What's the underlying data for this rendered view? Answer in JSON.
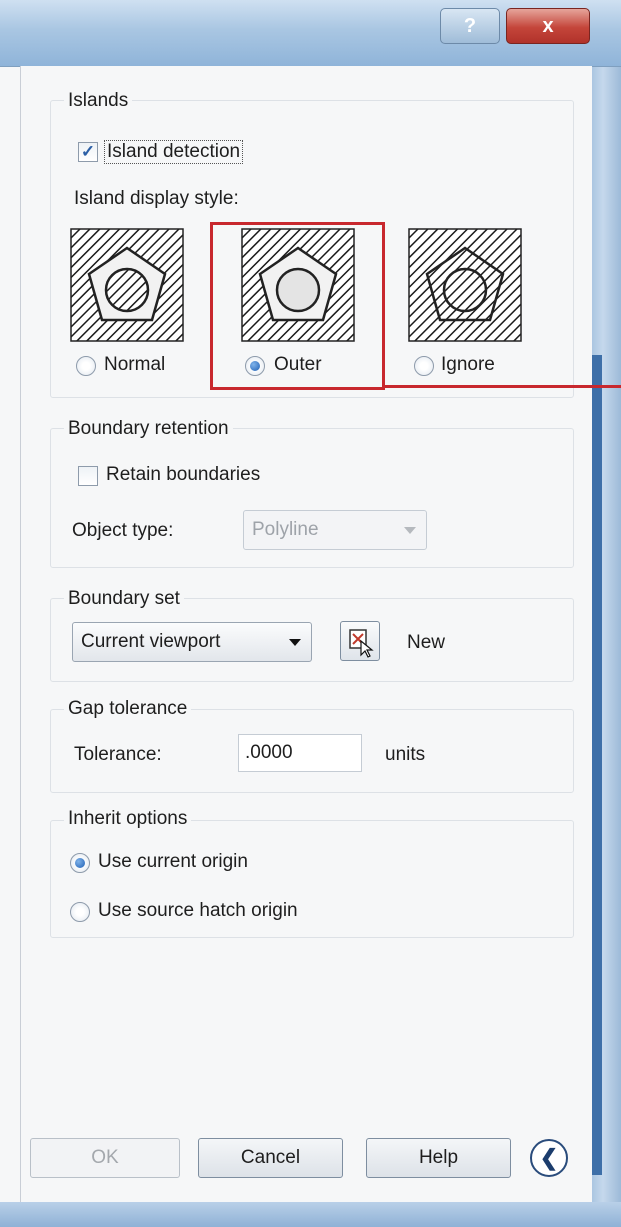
{
  "titlebar": {
    "help_label": "?",
    "close_label": "x"
  },
  "islands": {
    "group_label": "Islands",
    "island_detection": {
      "label": "Island detection",
      "checked": true,
      "check_glyph": "✓"
    },
    "display_style_label": "Island display style:",
    "styles": [
      {
        "label": "Normal",
        "selected": false
      },
      {
        "label": "Outer",
        "selected": true
      },
      {
        "label": "Ignore",
        "selected": false
      }
    ],
    "highlight_color": "#c8282e"
  },
  "boundary_retention": {
    "group_label": "Boundary retention",
    "retain_boundaries": {
      "label": "Retain boundaries",
      "checked": false
    },
    "object_type_label": "Object type:",
    "object_type_value": "Polyline"
  },
  "boundary_set": {
    "group_label": "Boundary set",
    "selected_value": "Current viewport",
    "new_label": "New"
  },
  "gap_tolerance": {
    "group_label": "Gap tolerance",
    "tolerance_label": "Tolerance:",
    "tolerance_value": ".0000",
    "units_label": "units"
  },
  "inherit_options": {
    "group_label": "Inherit options",
    "options": [
      {
        "label": "Use current origin",
        "selected": true
      },
      {
        "label": "Use source hatch origin",
        "selected": false
      }
    ]
  },
  "buttons": {
    "ok": "OK",
    "cancel": "Cancel",
    "help": "Help",
    "collapse_glyph": "❮"
  }
}
